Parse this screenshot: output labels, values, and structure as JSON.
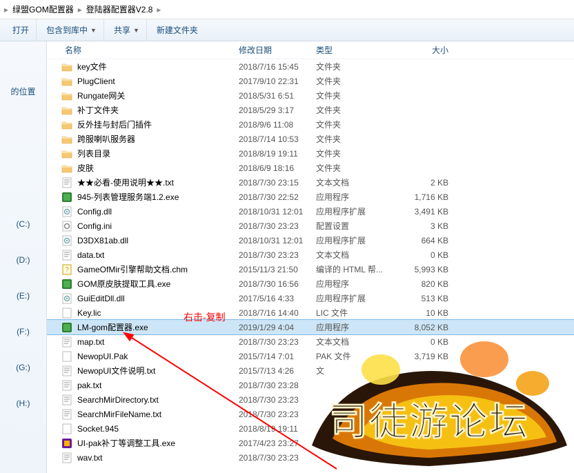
{
  "breadcrumb": {
    "items": [
      "绿盟GOM配置器",
      "登陆器配置器V2.8"
    ]
  },
  "toolbar": {
    "open": "打开",
    "include": "包含到库中",
    "share": "共享",
    "newfolder": "新建文件夹"
  },
  "sidebar": {
    "location_label": "的位置",
    "drives": [
      "(C:)",
      "(D:)",
      "(E:)",
      "(F:)",
      "(G:)",
      "(H:)"
    ]
  },
  "columns": {
    "name": "名称",
    "date": "修改日期",
    "type": "类型",
    "size": "大小"
  },
  "annotation_text": "右击-复制",
  "files": [
    {
      "icon": "folder",
      "name": "key文件",
      "date": "2018/7/16 15:45",
      "type": "文件夹",
      "size": ""
    },
    {
      "icon": "folder",
      "name": "PlugClient",
      "date": "2017/9/10 22:31",
      "type": "文件夹",
      "size": ""
    },
    {
      "icon": "folder",
      "name": "Rungate网关",
      "date": "2018/5/31 6:51",
      "type": "文件夹",
      "size": ""
    },
    {
      "icon": "folder",
      "name": "补丁文件夹",
      "date": "2018/5/29 3:17",
      "type": "文件夹",
      "size": ""
    },
    {
      "icon": "folder",
      "name": "反外挂与封后门插件",
      "date": "2018/9/6 11:08",
      "type": "文件夹",
      "size": ""
    },
    {
      "icon": "folder",
      "name": "跨服喇叭服务器",
      "date": "2018/7/14 10:53",
      "type": "文件夹",
      "size": ""
    },
    {
      "icon": "folder",
      "name": "列表目录",
      "date": "2018/8/19 19:11",
      "type": "文件夹",
      "size": ""
    },
    {
      "icon": "folder",
      "name": "皮肤",
      "date": "2018/6/9 18:16",
      "type": "文件夹",
      "size": ""
    },
    {
      "icon": "txt",
      "name": "★★必看-使用说明★★.txt",
      "date": "2018/7/30 23:15",
      "type": "文本文档",
      "size": "2 KB"
    },
    {
      "icon": "exe-green",
      "name": "945-列表管理服务端1.2.exe",
      "date": "2018/7/30 22:52",
      "type": "应用程序",
      "size": "1,716 KB"
    },
    {
      "icon": "dll",
      "name": "Config.dll",
      "date": "2018/10/31 12:01",
      "type": "应用程序扩展",
      "size": "3,491 KB"
    },
    {
      "icon": "ini",
      "name": "Config.ini",
      "date": "2018/7/30 23:23",
      "type": "配置设置",
      "size": "3 KB"
    },
    {
      "icon": "dll",
      "name": "D3DX81ab.dll",
      "date": "2018/10/31 12:01",
      "type": "应用程序扩展",
      "size": "664 KB"
    },
    {
      "icon": "txt",
      "name": "data.txt",
      "date": "2018/7/30 23:23",
      "type": "文本文档",
      "size": "0 KB"
    },
    {
      "icon": "chm",
      "name": "GameOfMir引擎帮助文档.chm",
      "date": "2015/11/3 21:50",
      "type": "编译的 HTML 帮...",
      "size": "5,993 KB"
    },
    {
      "icon": "exe-green",
      "name": "GOM原皮肤提取工具.exe",
      "date": "2018/7/30 16:56",
      "type": "应用程序",
      "size": "820 KB"
    },
    {
      "icon": "dll",
      "name": "GuiEditDll.dll",
      "date": "2017/5/16 4:33",
      "type": "应用程序扩展",
      "size": "513 KB"
    },
    {
      "icon": "file",
      "name": "Key.lic",
      "date": "2018/7/16 14:40",
      "type": "LIC 文件",
      "size": "10 KB"
    },
    {
      "icon": "exe-green",
      "name": "LM-gom配置器.exe",
      "date": "2019/1/29 4:04",
      "type": "应用程序",
      "size": "8,052 KB",
      "selected": true
    },
    {
      "icon": "txt",
      "name": "map.txt",
      "date": "2018/7/30 23:23",
      "type": "文本文档",
      "size": "0 KB"
    },
    {
      "icon": "file",
      "name": "NewopUI.Pak",
      "date": "2015/7/14 7:01",
      "type": "PAK 文件",
      "size": "3,719 KB"
    },
    {
      "icon": "txt",
      "name": "NewopUI文件说明.txt",
      "date": "2015/7/13 4:26",
      "type": "文",
      "size": ""
    },
    {
      "icon": "txt",
      "name": "pak.txt",
      "date": "2018/7/30 23:28",
      "type": "",
      "size": ""
    },
    {
      "icon": "txt",
      "name": "SearchMirDirectory.txt",
      "date": "2018/7/30 23:23",
      "type": "",
      "size": ""
    },
    {
      "icon": "txt",
      "name": "SearchMirFileName.txt",
      "date": "2018/7/30 23:23",
      "type": "",
      "size": ""
    },
    {
      "icon": "file",
      "name": "Socket.945",
      "date": "2018/8/19 19:11",
      "type": "",
      "size": ""
    },
    {
      "icon": "exe-color",
      "name": "UI-pak补丁等调整工具.exe",
      "date": "2017/4/23 23:27",
      "type": "应",
      "size": ""
    },
    {
      "icon": "txt",
      "name": "wav.txt",
      "date": "2018/7/30 23:23",
      "type": "",
      "size": ""
    }
  ]
}
